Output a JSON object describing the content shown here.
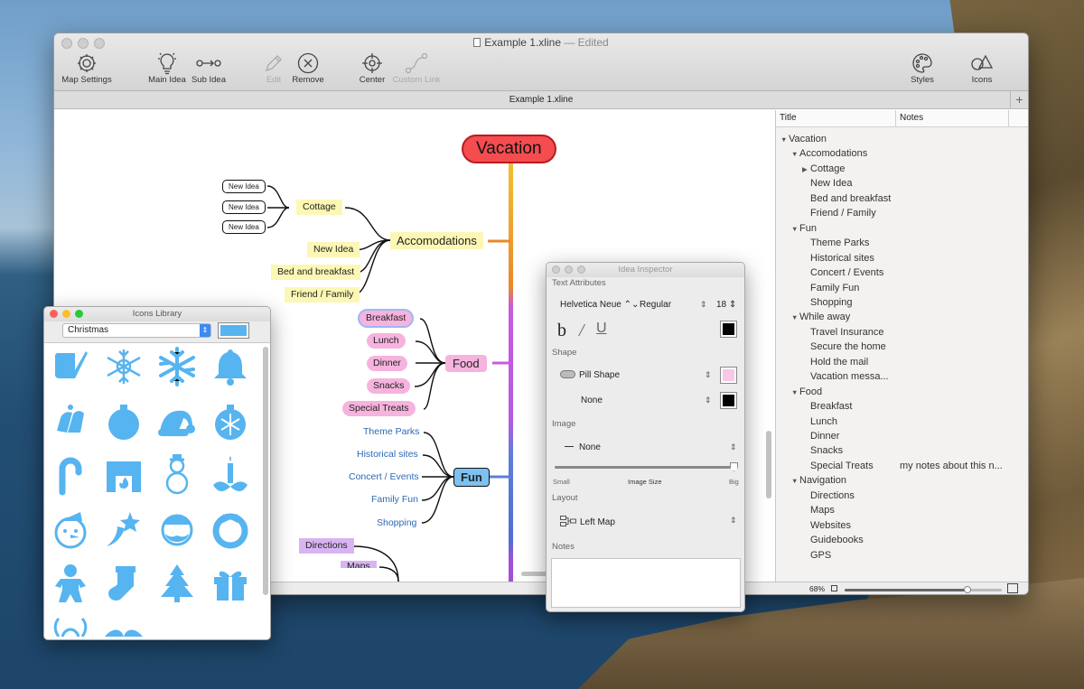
{
  "window": {
    "title": "Example 1.xline",
    "edited": "— Edited",
    "tab": "Example 1.xline"
  },
  "toolbar": {
    "map_settings": "Map Settings",
    "main_idea": "Main Idea",
    "sub_idea": "Sub Idea",
    "edit": "Edit",
    "remove": "Remove",
    "center": "Center",
    "custom_link": "Custom Link",
    "styles": "Styles",
    "icons": "Icons"
  },
  "map": {
    "root": "Vacation",
    "accom": "Accomodations",
    "cottage": "Cottage",
    "new_ideas": [
      "New Idea",
      "New Idea",
      "New Idea"
    ],
    "accom_children": [
      "New Idea",
      "Bed and breakfast",
      "Friend / Family"
    ],
    "food": "Food",
    "food_children": [
      "Breakfast",
      "Lunch",
      "Dinner",
      "Snacks",
      "Special Treats"
    ],
    "fun": "Fun",
    "fun_children": [
      "Theme Parks",
      "Historical sites",
      "Concert / Events",
      "Family Fun",
      "Shopping"
    ],
    "nav_children": [
      "Directions",
      "Maps"
    ]
  },
  "outline": {
    "col_title": "Title",
    "col_notes": "Notes",
    "rows": [
      {
        "t": "Vacation",
        "lvl": 0,
        "tri": "▼"
      },
      {
        "t": "Accomodations",
        "lvl": 1,
        "tri": "▼"
      },
      {
        "t": "Cottage",
        "lvl": 2,
        "tri": "▶"
      },
      {
        "t": "New Idea",
        "lvl": 2,
        "tri": ""
      },
      {
        "t": "Bed and breakfast",
        "lvl": 2,
        "tri": ""
      },
      {
        "t": "Friend / Family",
        "lvl": 2,
        "tri": ""
      },
      {
        "t": "Fun",
        "lvl": 1,
        "tri": "▼"
      },
      {
        "t": "Theme Parks",
        "lvl": 2,
        "tri": ""
      },
      {
        "t": "Historical sites",
        "lvl": 2,
        "tri": ""
      },
      {
        "t": "Concert / Events",
        "lvl": 2,
        "tri": ""
      },
      {
        "t": "Family Fun",
        "lvl": 2,
        "tri": ""
      },
      {
        "t": "Shopping",
        "lvl": 2,
        "tri": ""
      },
      {
        "t": "While away",
        "lvl": 1,
        "tri": "▼"
      },
      {
        "t": "Travel Insurance",
        "lvl": 2,
        "tri": ""
      },
      {
        "t": "Secure the home",
        "lvl": 2,
        "tri": ""
      },
      {
        "t": "Hold the mail",
        "lvl": 2,
        "tri": ""
      },
      {
        "t": "Vacation messa...",
        "lvl": 2,
        "tri": ""
      },
      {
        "t": "Food",
        "lvl": 1,
        "tri": "▼"
      },
      {
        "t": "Breakfast",
        "lvl": 2,
        "tri": ""
      },
      {
        "t": "Lunch",
        "lvl": 2,
        "tri": ""
      },
      {
        "t": "Dinner",
        "lvl": 2,
        "tri": ""
      },
      {
        "t": "Snacks",
        "lvl": 2,
        "tri": ""
      },
      {
        "t": "Special Treats",
        "lvl": 2,
        "tri": "",
        "note": "my notes about this n..."
      },
      {
        "t": "Navigation",
        "lvl": 1,
        "tri": "▼"
      },
      {
        "t": "Directions",
        "lvl": 2,
        "tri": ""
      },
      {
        "t": "Maps",
        "lvl": 2,
        "tri": ""
      },
      {
        "t": "Websites",
        "lvl": 2,
        "tri": ""
      },
      {
        "t": "Guidebooks",
        "lvl": 2,
        "tri": ""
      },
      {
        "t": "GPS",
        "lvl": 2,
        "tri": ""
      }
    ]
  },
  "status": {
    "zoom": "68%",
    "zoom_level": 0.78
  },
  "icons_library": {
    "title": "Icons Library",
    "category": "Christmas",
    "swatch_color": "#56b4f0",
    "icons": [
      "scroll-quill-icon",
      "snowflake-outline-icon",
      "snowflake-icon",
      "bell-icon",
      "bells-icon",
      "ornament-icon",
      "santa-hat-icon",
      "snow-ornament-icon",
      "candy-cane-icon",
      "fireplace-icon",
      "snowman-icon",
      "holly-candle-icon",
      "snowman-face-icon",
      "shooting-star-icon",
      "santa-face-icon",
      "wreath-icon",
      "gingerbread-icon",
      "stocking-icon",
      "tree-icon",
      "gift-icon"
    ]
  },
  "inspector": {
    "title": "Idea Inspector",
    "text_attributes": "Text Attributes",
    "font": "Helvetica Neue",
    "weight": "Regular",
    "size": "18",
    "shape_label": "Shape",
    "shape": "Pill Shape",
    "border": "None",
    "image_label": "Image",
    "image": "None",
    "small": "Small",
    "image_size": "Image Size",
    "big": "Big",
    "image_size_level": 1.0,
    "layout_label": "Layout",
    "layout": "Left Map",
    "notes_label": "Notes",
    "text_color": "#000000",
    "shape_color": "#f8c8e6",
    "border_color": "#000000"
  },
  "colors": {
    "root_fill": "#f44c4f",
    "accent_blue": "#7dc1f0",
    "icon_blue": "#56b4f0"
  }
}
